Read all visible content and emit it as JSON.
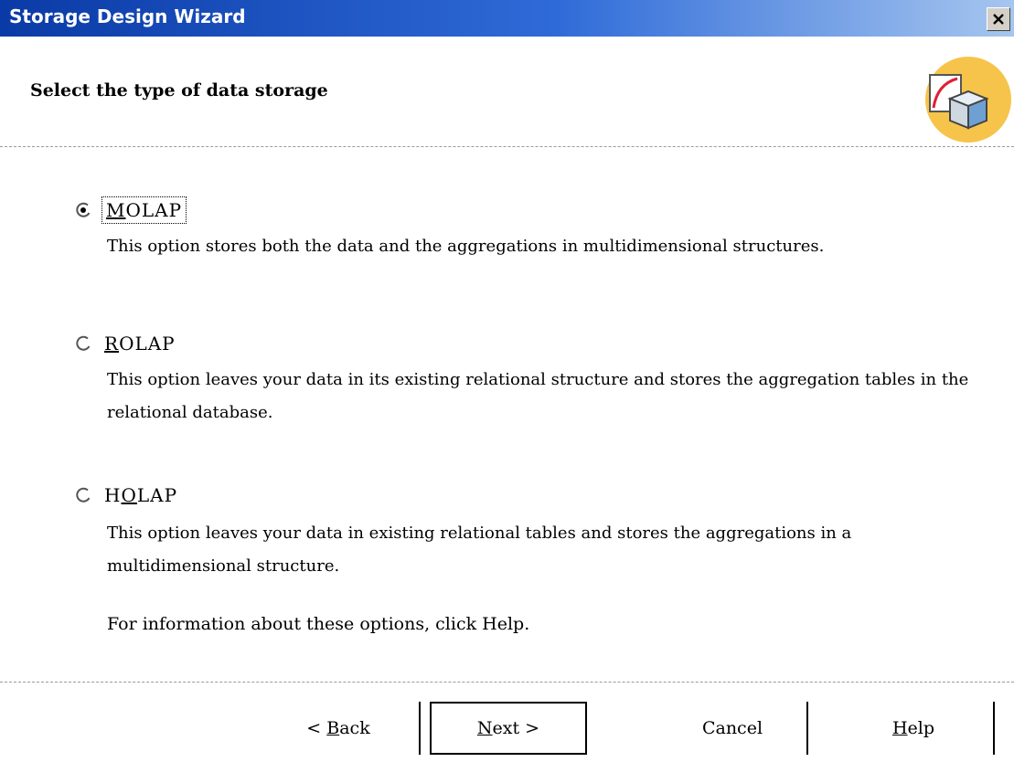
{
  "window": {
    "title": "Storage Design Wizard",
    "close_label": "×"
  },
  "header": {
    "title": "Select the type of data storage",
    "icon": "cube-icon"
  },
  "options": [
    {
      "key": "M",
      "rest": "OLAP",
      "selected": true,
      "description": "This option stores both the data and the aggregations in multidimensional structures."
    },
    {
      "key": "R",
      "rest": "OLAP",
      "selected": false,
      "description": "This option leaves your data in its existing relational structure and stores the aggregation tables in the relational database."
    },
    {
      "prefix": "H",
      "key": "O",
      "rest": "LAP",
      "selected": false,
      "description": "This option leaves your data in existing relational tables and stores the aggregations in a multidimensional structure."
    }
  ],
  "info_text": "For information about these options, click Help.",
  "buttons": {
    "back": {
      "prefix": "< ",
      "key": "B",
      "rest": "ack"
    },
    "next": {
      "key": "N",
      "rest": "ext >"
    },
    "cancel": {
      "label": "Cancel"
    },
    "help": {
      "key": "H",
      "rest": "elp"
    }
  },
  "colors": {
    "titlebar_start": "#0a3aa6",
    "titlebar_end": "#a6c6ef",
    "icon_circle": "#f6c44a"
  }
}
